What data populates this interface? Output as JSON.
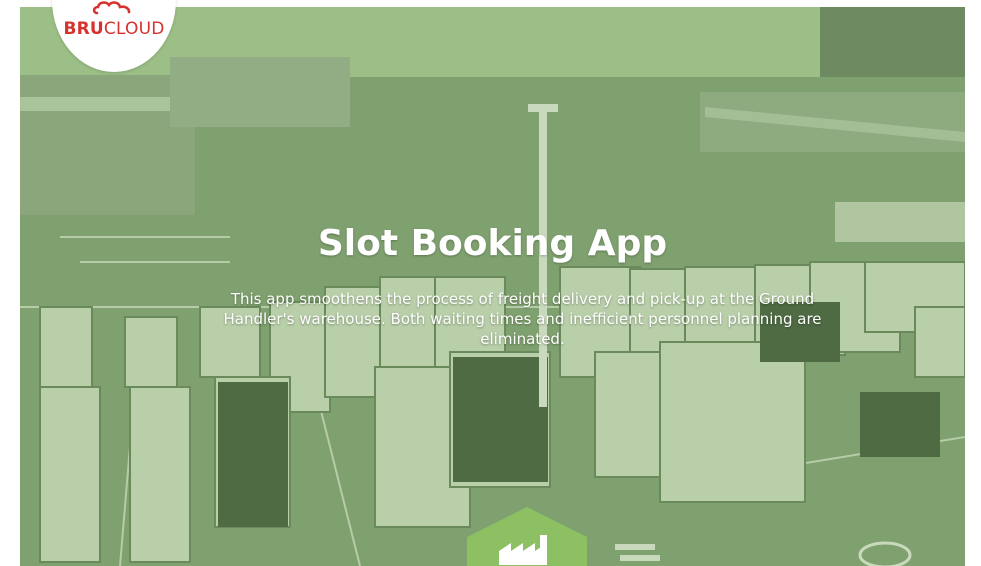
{
  "brand": {
    "name_bold": "BRU",
    "name_light": "CLOUD",
    "color": "#d6322e"
  },
  "hero": {
    "title": "Slot Booking App",
    "description": "This app smoothens the process of freight delivery and pick-up at the Ground Handler's warehouse. Both waiting times and inefficient personnel planning are eliminated.",
    "overlay_color": "#8cc063",
    "badge_icon": "factory-icon"
  }
}
